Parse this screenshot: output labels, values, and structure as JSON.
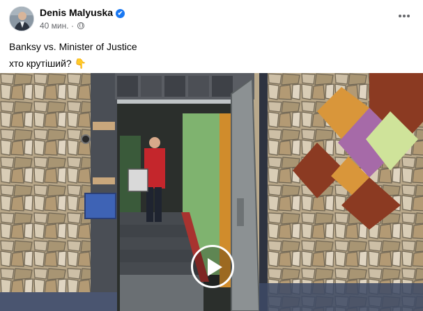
{
  "post": {
    "author": "Denis Malyuska",
    "timestamp": "40 мин.",
    "separator": "·",
    "text_line1": "Banksy vs. Minister of Justice",
    "text_line2": "хто крутіший?",
    "emoji": "👇",
    "verified_icon": "✔"
  },
  "icons": {
    "more": "more-options-icon",
    "globe": "globe-icon",
    "play": "play-icon"
  },
  "colors": {
    "verified_blue": "#1877f2",
    "meta_gray": "#65676b",
    "text": "#050505"
  }
}
